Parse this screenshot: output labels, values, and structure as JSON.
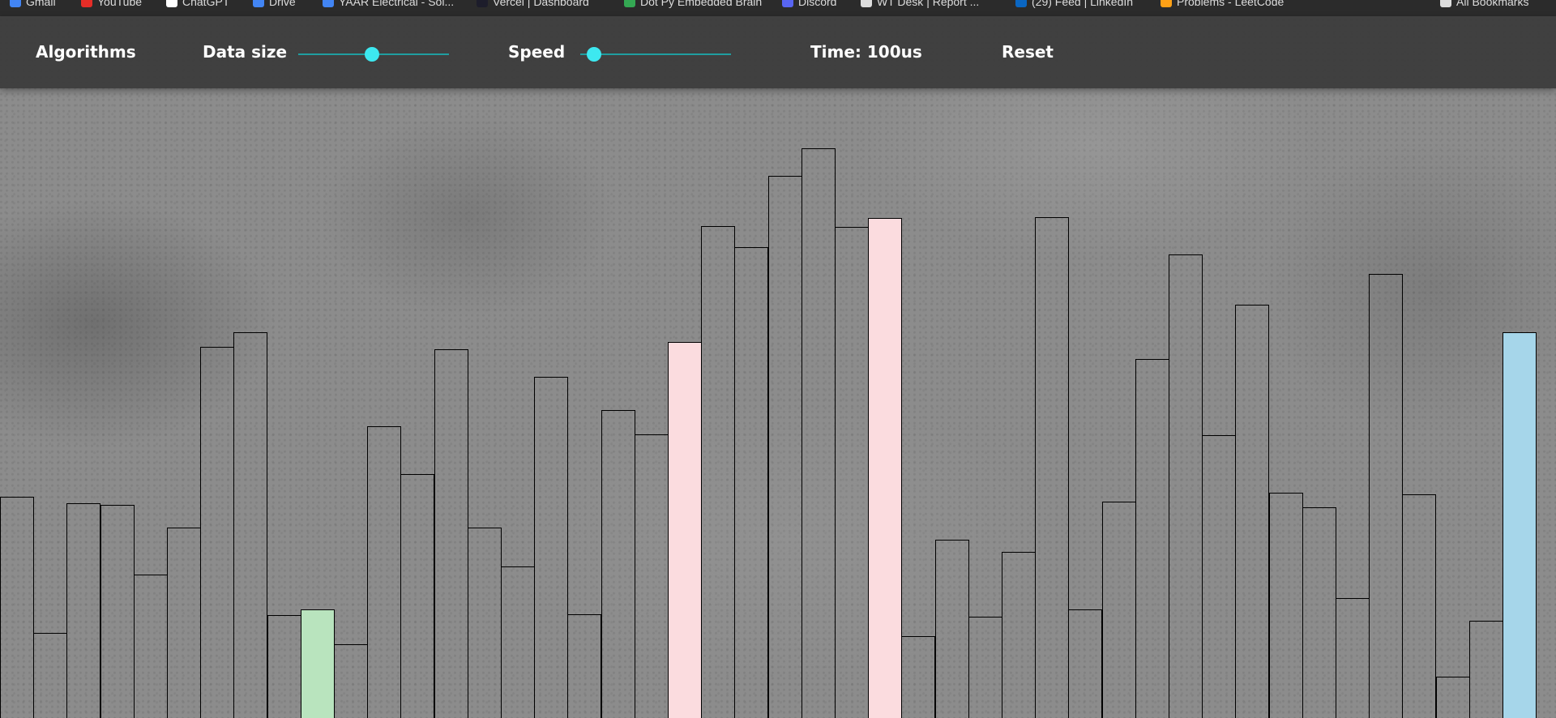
{
  "bookmarks": [
    {
      "label": "Gmail",
      "color": "#4285f4"
    },
    {
      "label": "YouTube",
      "color": "#e52d27"
    },
    {
      "label": "ChatGPT",
      "color": "#ffffff"
    },
    {
      "label": "Drive",
      "color": "#4285f4"
    },
    {
      "label": "YAAR Electrical - Sol...",
      "color": "#4285f4"
    },
    {
      "label": "Vercel | Dashboard",
      "color": "#1d1d2b"
    },
    {
      "label": "Dot Py Embedded Brain",
      "color": "#34a853"
    },
    {
      "label": "Discord",
      "color": "#5865f2"
    },
    {
      "label": "WT Desk | Report ...",
      "color": "#dddddd"
    },
    {
      "label": "(29) Feed | LinkedIn",
      "color": "#0a66c2"
    },
    {
      "label": "Problems - LeetCode",
      "color": "#ffa116"
    },
    {
      "label": "All Bookmarks",
      "color": "#dddddd"
    }
  ],
  "nav": {
    "algorithms_label": "Algorithms",
    "data_size_label": "Data size",
    "data_size_level": 0.49,
    "speed_label": "Speed",
    "speed_level": 0.09,
    "time_label": "Time: 100us",
    "reset_label": "Reset"
  },
  "colors": {
    "slider_thumb": "#3de8f0",
    "slider_track": "#1f9ea0",
    "bar_default": "transparent",
    "bar_sorted": "#b9e4be",
    "bar_compare": "#fbdcdf",
    "bar_pivot": "#a6d6ea"
  },
  "bars": [
    {
      "value": 222,
      "state": "default"
    },
    {
      "value": 86,
      "state": "default"
    },
    {
      "value": 215,
      "state": "default"
    },
    {
      "value": 214,
      "state": "default"
    },
    {
      "value": 144,
      "state": "default"
    },
    {
      "value": 191,
      "state": "default"
    },
    {
      "value": 371,
      "state": "default"
    },
    {
      "value": 385,
      "state": "default"
    },
    {
      "value": 104,
      "state": "default"
    },
    {
      "value": 110,
      "state": "sorted"
    },
    {
      "value": 75,
      "state": "default"
    },
    {
      "value": 292,
      "state": "default"
    },
    {
      "value": 244,
      "state": "default"
    },
    {
      "value": 368,
      "state": "default"
    },
    {
      "value": 191,
      "state": "default"
    },
    {
      "value": 152,
      "state": "default"
    },
    {
      "value": 341,
      "state": "default"
    },
    {
      "value": 105,
      "state": "default"
    },
    {
      "value": 308,
      "state": "default"
    },
    {
      "value": 284,
      "state": "default"
    },
    {
      "value": 376,
      "state": "compare"
    },
    {
      "value": 491,
      "state": "default"
    },
    {
      "value": 470,
      "state": "default"
    },
    {
      "value": 541,
      "state": "default"
    },
    {
      "value": 568,
      "state": "default"
    },
    {
      "value": 490,
      "state": "default"
    },
    {
      "value": 499,
      "state": "compare"
    },
    {
      "value": 83,
      "state": "default"
    },
    {
      "value": 179,
      "state": "default"
    },
    {
      "value": 102,
      "state": "default"
    },
    {
      "value": 167,
      "state": "default"
    },
    {
      "value": 500,
      "state": "default"
    },
    {
      "value": 110,
      "state": "default"
    },
    {
      "value": 217,
      "state": "default"
    },
    {
      "value": 359,
      "state": "default"
    },
    {
      "value": 463,
      "state": "default"
    },
    {
      "value": 283,
      "state": "default"
    },
    {
      "value": 413,
      "state": "default"
    },
    {
      "value": 226,
      "state": "default"
    },
    {
      "value": 211,
      "state": "default"
    },
    {
      "value": 121,
      "state": "default"
    },
    {
      "value": 443,
      "state": "default"
    },
    {
      "value": 224,
      "state": "default"
    },
    {
      "value": 43,
      "state": "default"
    },
    {
      "value": 98,
      "state": "default"
    },
    {
      "value": 385,
      "state": "pivot"
    }
  ]
}
